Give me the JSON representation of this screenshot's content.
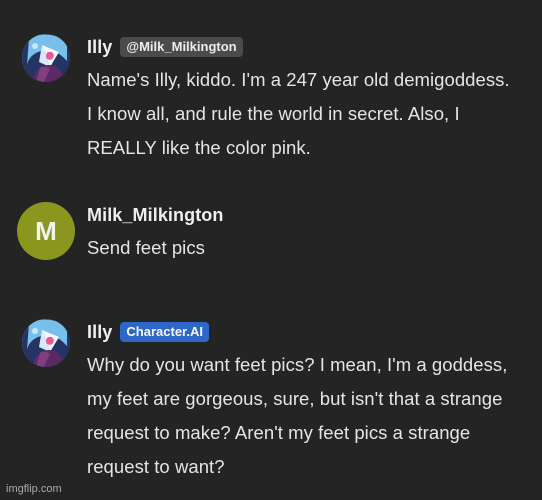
{
  "messages": [
    {
      "name": "Illy",
      "tag": "@Milk_Milkington",
      "tag_type": "user",
      "avatar_icon": "character-avatar-icon",
      "text": "Name's Illy, kiddo. I'm a 247 year old demigoddess. I know all, and rule the world in secret. Also, I REALLY like the color pink."
    },
    {
      "name": "Milk_Milkington",
      "avatar_letter": "M",
      "text": "Send feet pics"
    },
    {
      "name": "Illy",
      "tag": "Character.AI",
      "tag_type": "ai",
      "avatar_icon": "character-avatar-icon",
      "text": "Why do you want feet pics? I mean, I'm a goddess, my feet are gorgeous, sure, but isn't that a strange request to make? Aren't my feet pics a strange request to want?"
    }
  ],
  "watermark": "imgflip.com",
  "colors": {
    "background": "#242424",
    "text": "#e5e5e5",
    "user_tag": "#4b4b4b",
    "ai_tag": "#2d67c8",
    "user_avatar": "#8a961d"
  }
}
